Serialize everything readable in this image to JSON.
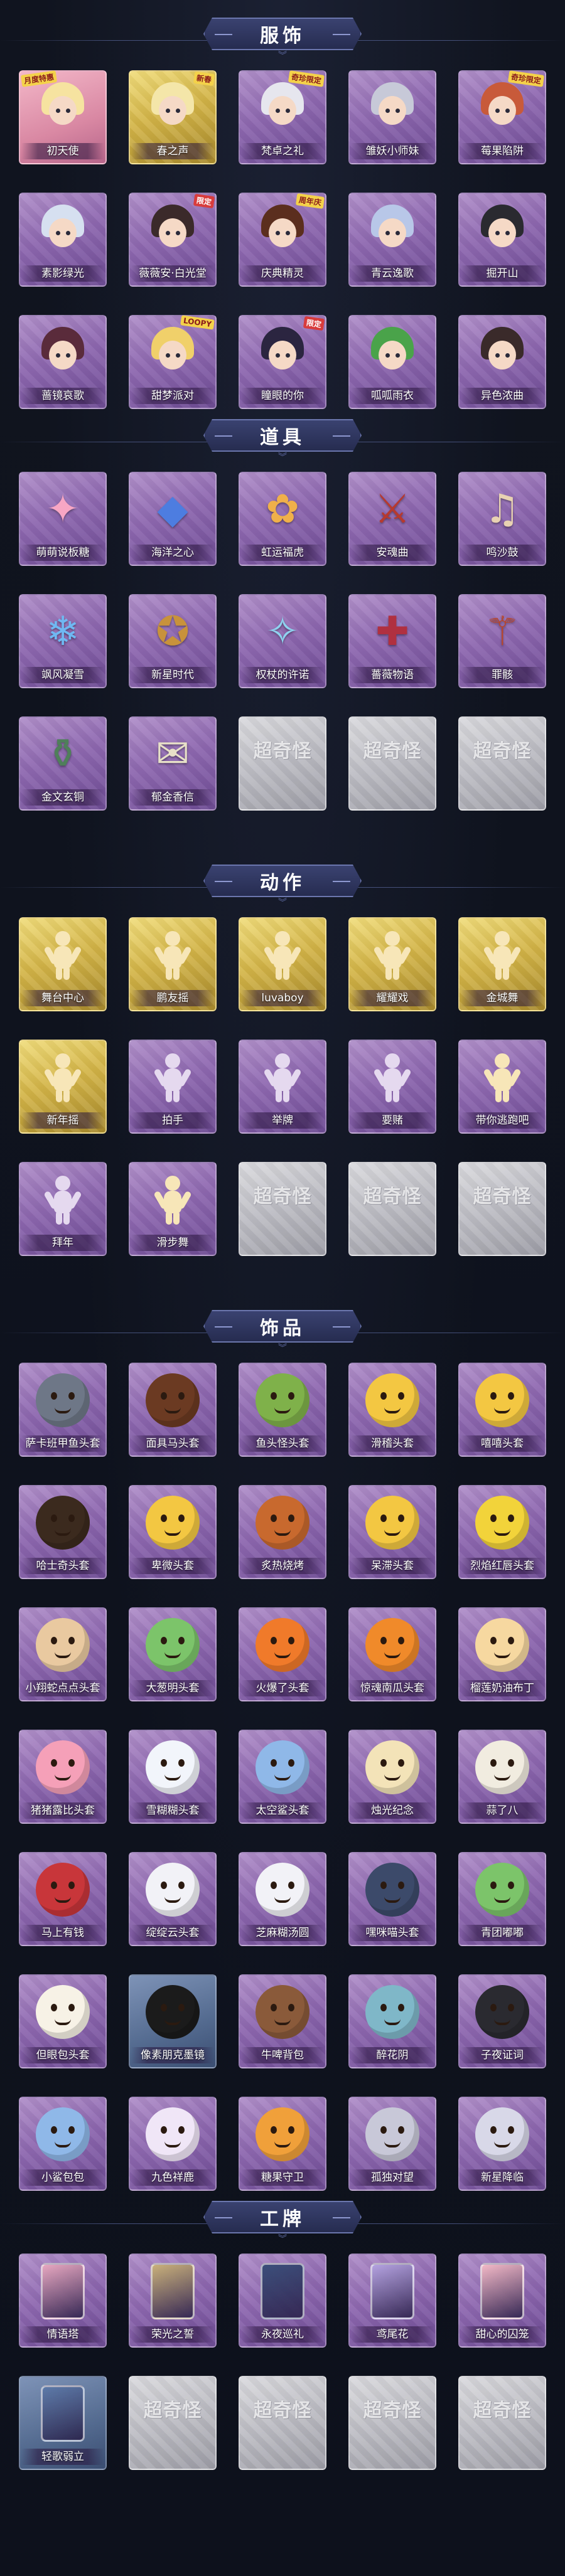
{
  "sections": [
    {
      "title": "服饰",
      "items": [
        {
          "name": "初天使",
          "style": "pink",
          "icon": "portrait-angel-icon",
          "badge": "月度特惠",
          "badge_side": "left",
          "hair": "#f6e3a0"
        },
        {
          "name": "春之声",
          "style": "gold",
          "icon": "portrait-spring-icon",
          "badge": "新春",
          "badge_side": "right",
          "hair": "#f4e6a9"
        },
        {
          "name": "梵卓之礼",
          "style": "purple",
          "icon": "portrait-vampire-icon",
          "badge": "奇珍限定",
          "badge_side": "right",
          "hair": "#e6e6ee"
        },
        {
          "name": "雏妖小师妹",
          "style": "purple",
          "icon": "portrait-fox-girl-icon",
          "badge": "",
          "badge_side": "right",
          "hair": "#c7c9d8"
        },
        {
          "name": "莓果陷阱",
          "style": "purple",
          "icon": "portrait-berry-icon",
          "badge": "奇珍限定",
          "badge_side": "right",
          "hair": "#c85a3a"
        },
        {
          "name": "素影绿光",
          "style": "purple",
          "icon": "portrait-moonlight-icon",
          "badge": "",
          "badge_side": "right",
          "hair": "#d6e0f0"
        },
        {
          "name": "薇薇安·白光堂",
          "style": "purple",
          "icon": "portrait-vivian-icon",
          "badge": "限定",
          "badge_side": "right",
          "hair": "#3b2a2a"
        },
        {
          "name": "庆典精灵",
          "style": "purple",
          "icon": "portrait-festival-icon",
          "badge": "周年庆",
          "badge_side": "right",
          "hair": "#5b2e1e"
        },
        {
          "name": "青云逸歌",
          "style": "purple",
          "icon": "portrait-cloud-icon",
          "badge": "",
          "badge_side": "right",
          "hair": "#b8c7e8"
        },
        {
          "name": "掘开山",
          "style": "purple",
          "icon": "portrait-digger-icon",
          "badge": "",
          "badge_side": "right",
          "hair": "#2a2a30"
        },
        {
          "name": "蔷镜哀歌",
          "style": "purple",
          "icon": "portrait-rose-icon",
          "badge": "",
          "badge_side": "right",
          "hair": "#5a2b3b"
        },
        {
          "name": "甜梦派对",
          "style": "purple",
          "icon": "portrait-sweet-icon",
          "badge": "LOOPY",
          "badge_side": "right",
          "hair": "#f0d06a"
        },
        {
          "name": "瞳眼的你",
          "style": "purple",
          "icon": "portrait-witch-icon",
          "badge": "限定",
          "badge_side": "right",
          "hair": "#2b2540"
        },
        {
          "name": "呱呱雨衣",
          "style": "purple",
          "icon": "portrait-frog-icon",
          "badge": "",
          "badge_side": "right",
          "hair": "#4aa34a"
        },
        {
          "name": "异色浓曲",
          "style": "purple",
          "icon": "portrait-mask-icon",
          "badge": "",
          "badge_side": "right",
          "hair": "#3a2a2a"
        }
      ]
    },
    {
      "title": "道具",
      "items": [
        {
          "name": "萌萌说板糖",
          "style": "purple",
          "icon": "wand-icon",
          "glyph": "✦",
          "color": "#f7a6c4"
        },
        {
          "name": "海洋之心",
          "style": "purple",
          "icon": "necklace-icon",
          "glyph": "◆",
          "color": "#4d7de0"
        },
        {
          "name": "虹运福虎",
          "style": "purple",
          "icon": "tiger-icon",
          "glyph": "✿",
          "color": "#f0b04a"
        },
        {
          "name": "安魂曲",
          "style": "purple",
          "icon": "sword-icon",
          "glyph": "⚔",
          "color": "#b6392f"
        },
        {
          "name": "鸣沙鼓",
          "style": "purple",
          "icon": "drum-icon",
          "glyph": "♫",
          "color": "#e8d2b2"
        },
        {
          "name": "飒风凝雪",
          "style": "purple",
          "icon": "ice-orb-icon",
          "glyph": "❄",
          "color": "#6fb8f2"
        },
        {
          "name": "新星时代",
          "style": "purple",
          "icon": "revolver-icon",
          "glyph": "✪",
          "color": "#c8923b"
        },
        {
          "name": "权杖的许诺",
          "style": "purple",
          "icon": "scepter-icon",
          "glyph": "✧",
          "color": "#8fd3f0"
        },
        {
          "name": "薔薇物语",
          "style": "purple",
          "icon": "medkit-icon",
          "glyph": "✚",
          "color": "#b03040"
        },
        {
          "name": "罪骸",
          "style": "purple",
          "icon": "staff-icon",
          "glyph": "⚚",
          "color": "#b8462c"
        },
        {
          "name": "金文玄铜",
          "style": "purple",
          "icon": "bronze-flask-icon",
          "glyph": "⚱",
          "color": "#4f7f5a"
        },
        {
          "name": "郁金香信",
          "style": "purple",
          "icon": "tulip-letter-icon",
          "glyph": "✉",
          "color": "#e8e1c8"
        },
        {
          "name": "",
          "style": "grey",
          "icon": "placeholder-logo-icon",
          "logo": "超奇怪"
        },
        {
          "name": "",
          "style": "grey",
          "icon": "placeholder-logo-icon",
          "logo": "超奇怪"
        },
        {
          "name": "",
          "style": "grey",
          "icon": "placeholder-logo-icon",
          "logo": "超奇怪"
        }
      ]
    },
    {
      "title": "动作",
      "items": [
        {
          "name": "舞台中心",
          "style": "gold",
          "icon": "emote-stage-icon",
          "color": "#f7e6b8"
        },
        {
          "name": "鹏友摇",
          "style": "gold",
          "icon": "emote-wave-icon",
          "color": "#f7e6b8"
        },
        {
          "name": "luvaboy",
          "style": "gold",
          "icon": "emote-luvaboy-icon",
          "color": "#f7e6b8"
        },
        {
          "name": "耀耀戏",
          "style": "gold",
          "icon": "emote-play-icon",
          "color": "#f7e6b8"
        },
        {
          "name": "金城舞",
          "style": "gold",
          "icon": "emote-dance-icon",
          "color": "#f7e6b8"
        },
        {
          "name": "新年摇",
          "style": "gold",
          "icon": "emote-newyear-icon",
          "color": "#f7e6b8"
        },
        {
          "name": "拍手",
          "style": "purple",
          "icon": "emote-clap-icon",
          "color": "#e5d9ef"
        },
        {
          "name": "举牌",
          "style": "purple",
          "icon": "emote-sign-icon",
          "color": "#e5d9ef"
        },
        {
          "name": "要赌",
          "style": "purple",
          "icon": "emote-bet-icon",
          "color": "#e5d9ef"
        },
        {
          "name": "带你逃跑吧",
          "style": "purple",
          "icon": "emote-run-icon",
          "color": "#f7e6b8"
        },
        {
          "name": "拜年",
          "style": "purple",
          "icon": "emote-bow-icon",
          "color": "#e5d9ef"
        },
        {
          "name": "滑步舞",
          "style": "purple",
          "icon": "emote-slide-icon",
          "color": "#f7e6b8"
        },
        {
          "name": "",
          "style": "grey",
          "icon": "placeholder-logo-icon",
          "logo": "超奇怪"
        },
        {
          "name": "",
          "style": "grey",
          "icon": "placeholder-logo-icon",
          "logo": "超奇怪"
        },
        {
          "name": "",
          "style": "grey",
          "icon": "placeholder-logo-icon",
          "logo": "超奇怪"
        }
      ]
    },
    {
      "title": "饰品",
      "items": [
        {
          "name": "萨卡班甲鱼头套",
          "style": "purple",
          "icon": "fish-head-icon",
          "color": "#6e7787"
        },
        {
          "name": "面具马头套",
          "style": "purple",
          "icon": "horse-head-icon",
          "color": "#6b3a22"
        },
        {
          "name": "鱼头怪头套",
          "style": "purple",
          "icon": "fishman-head-icon",
          "color": "#7fb14a"
        },
        {
          "name": "滑稽头套",
          "style": "purple",
          "icon": "funny-face-icon",
          "color": "#f3c742"
        },
        {
          "name": "嘻嘻头套",
          "style": "purple",
          "icon": "grin-face-icon",
          "color": "#f3c742"
        },
        {
          "name": "哈士奇头套",
          "style": "purple",
          "icon": "husky-head-icon",
          "color": "#3b2a1e"
        },
        {
          "name": "卑微头套",
          "style": "purple",
          "icon": "sad-face-icon",
          "color": "#f3c742"
        },
        {
          "name": "炙热烧烤",
          "style": "purple",
          "icon": "grill-head-icon",
          "color": "#c8692e"
        },
        {
          "name": "呆滞头套",
          "style": "purple",
          "icon": "dull-face-icon",
          "color": "#f3c742"
        },
        {
          "name": "烈焰红唇头套",
          "style": "purple",
          "icon": "pikachu-head-icon",
          "color": "#f2d33a"
        },
        {
          "name": "小翔蛇点点头套",
          "style": "purple",
          "icon": "snake-head-icon",
          "color": "#e9c9a0"
        },
        {
          "name": "大葱明头套",
          "style": "purple",
          "icon": "bokchoy-head-icon",
          "color": "#7cc46a"
        },
        {
          "name": "火爆了头套",
          "style": "purple",
          "icon": "fire-head-icon",
          "color": "#f07a2a"
        },
        {
          "name": "惊魂南瓜头套",
          "style": "purple",
          "icon": "pumpkin-head-icon",
          "color": "#f08a2a"
        },
        {
          "name": "榴莲奶油布丁",
          "style": "purple",
          "icon": "pudding-head-icon",
          "color": "#f6d8a0"
        },
        {
          "name": "猪猪露比头套",
          "style": "purple",
          "icon": "pig-head-icon",
          "color": "#f5a0b8"
        },
        {
          "name": "雪糊糊头套",
          "style": "purple",
          "icon": "snowman-head-icon",
          "color": "#f2f5fb"
        },
        {
          "name": "太空鲨头套",
          "style": "purple",
          "icon": "shark-head-icon",
          "color": "#8fb8e8"
        },
        {
          "name": "烛光纪念",
          "style": "purple",
          "icon": "candle-head-icon",
          "color": "#f3e3b8"
        },
        {
          "name": "蒜了八",
          "style": "purple",
          "icon": "garlic-head-icon",
          "color": "#f1ece0"
        },
        {
          "name": "马上有钱",
          "style": "purple",
          "icon": "money-head-icon",
          "color": "#c8363a"
        },
        {
          "name": "绽绽云头套",
          "style": "purple",
          "icon": "cloud-head-icon",
          "color": "#f2f2f7"
        },
        {
          "name": "芝麻糊汤圆",
          "style": "purple",
          "icon": "dumpling-head-icon",
          "color": "#f2f2f7"
        },
        {
          "name": "嘿咪喵头套",
          "style": "purple",
          "icon": "cat-head-icon",
          "color": "#3c4a6a"
        },
        {
          "name": "青团嘟嘟",
          "style": "purple",
          "icon": "qingtuan-head-icon",
          "color": "#7cc46a"
        },
        {
          "name": "但眼包头套",
          "style": "purple",
          "icon": "egg-head-icon",
          "color": "#f7f2e6"
        },
        {
          "name": "像素朋克墨镜",
          "style": "blue",
          "icon": "pixel-glasses-icon",
          "color": "#1b1b1b"
        },
        {
          "name": "牛啤背包",
          "style": "purple",
          "icon": "beer-backpack-icon",
          "color": "#8a5a3a"
        },
        {
          "name": "醉花阴",
          "style": "purple",
          "icon": "flower-crown-icon",
          "color": "#7fb7c8"
        },
        {
          "name": "子夜证词",
          "style": "purple",
          "icon": "doll-charm-icon",
          "color": "#2a2a30"
        },
        {
          "name": "小鲨包包",
          "style": "purple",
          "icon": "shark-bag-icon",
          "color": "#8fb8e8"
        },
        {
          "name": "九色祥鹿",
          "style": "purple",
          "icon": "deer-charm-icon",
          "color": "#f0e6f7"
        },
        {
          "name": "糖果守卫",
          "style": "purple",
          "icon": "candy-guard-icon",
          "color": "#f0a03a"
        },
        {
          "name": "孤独对望",
          "style": "purple",
          "icon": "lonely-charm-icon",
          "color": "#c8c8d8"
        },
        {
          "name": "新星降临",
          "style": "purple",
          "icon": "star-doll-icon",
          "color": "#d8d8e8"
        }
      ]
    },
    {
      "title": "工牌",
      "items": [
        {
          "name": "情语塔",
          "style": "purple",
          "icon": "badge-love-tower-icon",
          "color": "#e7a7c0"
        },
        {
          "name": "荣光之誓",
          "style": "purple",
          "icon": "badge-glory-icon",
          "color": "#c9b07a"
        },
        {
          "name": "永夜巡礼",
          "style": "purple",
          "icon": "badge-eternal-night-icon",
          "color": "#3b4e7a"
        },
        {
          "name": "鸢尾花",
          "style": "purple",
          "icon": "badge-iris-icon",
          "color": "#b4a2e0"
        },
        {
          "name": "甜心的囚笼",
          "style": "purple",
          "icon": "badge-sweetheart-icon",
          "color": "#f2b8c6"
        },
        {
          "name": "轻歌弱立",
          "style": "blue",
          "icon": "badge-ballad-icon",
          "color": "#5d7aa8"
        },
        {
          "name": "",
          "style": "grey",
          "icon": "placeholder-logo-icon",
          "logo": "超奇怪"
        },
        {
          "name": "",
          "style": "grey",
          "icon": "placeholder-logo-icon",
          "logo": "超奇怪"
        },
        {
          "name": "",
          "style": "grey",
          "icon": "placeholder-logo-icon",
          "logo": "超奇怪"
        },
        {
          "name": "",
          "style": "grey",
          "icon": "placeholder-logo-icon",
          "logo": "超奇怪"
        }
      ]
    }
  ]
}
